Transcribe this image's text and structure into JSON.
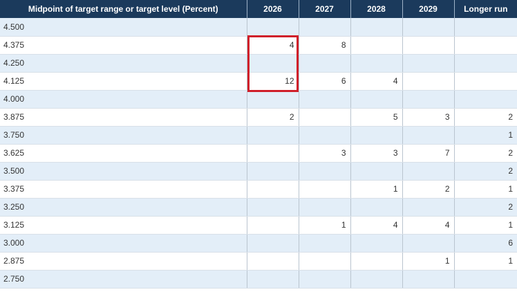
{
  "headers": [
    "Midpoint of target range or target level (Percent)",
    "2026",
    "2027",
    "2028",
    "2029",
    "Longer run"
  ],
  "rows": [
    [
      "4.500",
      "",
      "",
      "",
      "",
      ""
    ],
    [
      "4.375",
      "4",
      "8",
      "",
      "",
      ""
    ],
    [
      "4.250",
      "",
      "",
      "",
      "",
      ""
    ],
    [
      "4.125",
      "12",
      "6",
      "4",
      "",
      ""
    ],
    [
      "4.000",
      "",
      "",
      "",
      "",
      ""
    ],
    [
      "3.875",
      "2",
      "",
      "5",
      "3",
      "2"
    ],
    [
      "3.750",
      "",
      "",
      "",
      "",
      "1"
    ],
    [
      "3.625",
      "",
      "3",
      "3",
      "7",
      "2"
    ],
    [
      "3.500",
      "",
      "",
      "",
      "",
      "2"
    ],
    [
      "3.375",
      "",
      "",
      "1",
      "2",
      "1"
    ],
    [
      "3.250",
      "",
      "",
      "",
      "",
      "2"
    ],
    [
      "3.125",
      "",
      "1",
      "4",
      "4",
      "1"
    ],
    [
      "3.000",
      "",
      "",
      "",
      "",
      "6"
    ],
    [
      "2.875",
      "",
      "",
      "",
      "1",
      "1"
    ],
    [
      "2.750",
      "",
      "",
      "",
      "",
      ""
    ]
  ],
  "colors": {
    "header_bg": "#1b3a5c",
    "row_shade": "#e3eef8",
    "highlight": "#d01f2a"
  }
}
